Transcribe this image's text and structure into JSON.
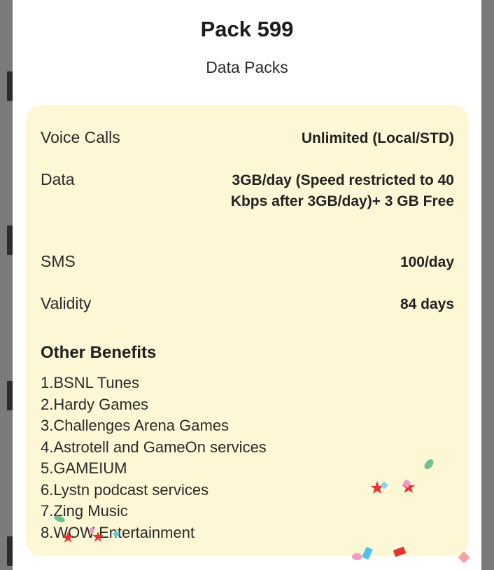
{
  "header": {
    "title": "Pack 599",
    "subtitle": "Data Packs"
  },
  "details": [
    {
      "label": "Voice Calls",
      "value": "Unlimited (Local/STD)"
    },
    {
      "label": "Data",
      "value": "3GB/day  (Speed restricted to 40 Kbps after 3GB/day)+ 3 GB Free"
    },
    {
      "label": "SMS",
      "value": "100/day"
    },
    {
      "label": "Validity",
      "value": "84 days"
    }
  ],
  "benefits": {
    "heading": "Other Benefits",
    "items": [
      "1.BSNL Tunes",
      "2.Hardy Games",
      "3.Challenges Arena Games",
      "4.Astrotell and GameOn services",
      "5.GAMEIUM",
      "6.Lystn podcast services",
      "7.Zing Music",
      "8.WOW Entertainment"
    ]
  },
  "colors": {
    "card_background": "#fdf7d6",
    "sheet_background": "#ffffff",
    "overlay": "#7a7a7a"
  }
}
